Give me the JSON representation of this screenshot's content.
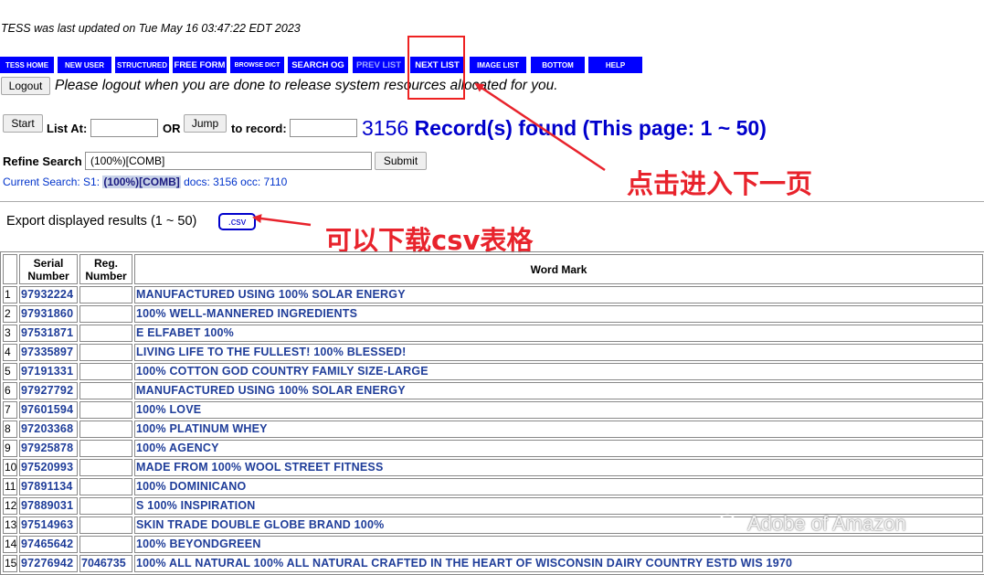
{
  "header": {
    "updated_text": "TESS was last updated on Tue May 16 03:47:22 EDT 2023"
  },
  "nav": [
    {
      "label": "TESS Home",
      "disabled": false
    },
    {
      "label": "New User",
      "disabled": false
    },
    {
      "label": "Structured",
      "disabled": false
    },
    {
      "label": "Free Form",
      "disabled": false
    },
    {
      "label": "Browse Dict",
      "disabled": false
    },
    {
      "label": "Search OG",
      "disabled": false
    },
    {
      "label": "Prev List",
      "disabled": true
    },
    {
      "label": "Next List",
      "disabled": false
    },
    {
      "label": "Image List",
      "disabled": false
    },
    {
      "label": "Bottom",
      "disabled": false
    },
    {
      "label": "Help",
      "disabled": false
    }
  ],
  "logout": {
    "button_label": "Logout",
    "message": "Please logout when you are done to release system resources allocated for you."
  },
  "list_controls": {
    "start_label": "Start",
    "list_at_label": "List At:",
    "list_at_value": "",
    "or_label": "OR",
    "jump_label": "Jump",
    "to_record_label": "to record:",
    "to_record_value": "",
    "record_count": "3156",
    "record_text": "Record(s) found (This page: 1 ~ 50)"
  },
  "refine": {
    "label": "Refine Search",
    "value": "(100%)[COMB]",
    "submit_label": "Submit"
  },
  "current_search": {
    "label": "Current Search:",
    "set": "S1:",
    "query": "(100%)[COMB]",
    "stats": "docs: 3156 occ: 7110"
  },
  "export": {
    "text": "Export displayed results (1 ~ 50)",
    "csv_label": ".csv"
  },
  "annotations": {
    "next_page": "点击进入下一页",
    "csv_download": "可以下载csv表格",
    "color": "#e8232c"
  },
  "table": {
    "headers": {
      "index": "",
      "serial": "Serial Number",
      "reg": "Reg. Number",
      "mark": "Word Mark"
    },
    "rows": [
      {
        "n": "1",
        "serial": "97932224",
        "reg": "",
        "mark": "MANUFACTURED USING 100% SOLAR ENERGY"
      },
      {
        "n": "2",
        "serial": "97931860",
        "reg": "",
        "mark": "100% WELL-MANNERED INGREDIENTS"
      },
      {
        "n": "3",
        "serial": "97531871",
        "reg": "",
        "mark": "E ELFABET 100%"
      },
      {
        "n": "4",
        "serial": "97335897",
        "reg": "",
        "mark": "LIVING LIFE TO THE FULLEST! 100% BLESSED!"
      },
      {
        "n": "5",
        "serial": "97191331",
        "reg": "",
        "mark": "100% COTTON GOD COUNTRY FAMILY SIZE-LARGE"
      },
      {
        "n": "6",
        "serial": "97927792",
        "reg": "",
        "mark": "MANUFACTURED USING 100% SOLAR ENERGY"
      },
      {
        "n": "7",
        "serial": "97601594",
        "reg": "",
        "mark": "100% LOVE"
      },
      {
        "n": "8",
        "serial": "97203368",
        "reg": "",
        "mark": "100% PLATINUM WHEY"
      },
      {
        "n": "9",
        "serial": "97925878",
        "reg": "",
        "mark": "100% AGENCY"
      },
      {
        "n": "10",
        "serial": "97520993",
        "reg": "",
        "mark": "MADE FROM 100% WOOL STREET FITNESS"
      },
      {
        "n": "11",
        "serial": "97891134",
        "reg": "",
        "mark": "100% DOMINICANO"
      },
      {
        "n": "12",
        "serial": "97889031",
        "reg": "",
        "mark": "S 100% INSPIRATION"
      },
      {
        "n": "13",
        "serial": "97514963",
        "reg": "",
        "mark": "SKIN TRADE DOUBLE GLOBE BRAND 100%"
      },
      {
        "n": "14",
        "serial": "97465642",
        "reg": "",
        "mark": "100% BEYONDGREEN"
      },
      {
        "n": "15",
        "serial": "97276942",
        "reg": "7046735",
        "mark": "100% ALL NATURAL 100% ALL NATURAL CRAFTED IN THE HEART OF WISCONSIN DAIRY COUNTRY ESTD WIS 1970"
      }
    ]
  },
  "watermark": {
    "text": "Adobe of Amazon",
    "icon": "wechat-icon"
  }
}
